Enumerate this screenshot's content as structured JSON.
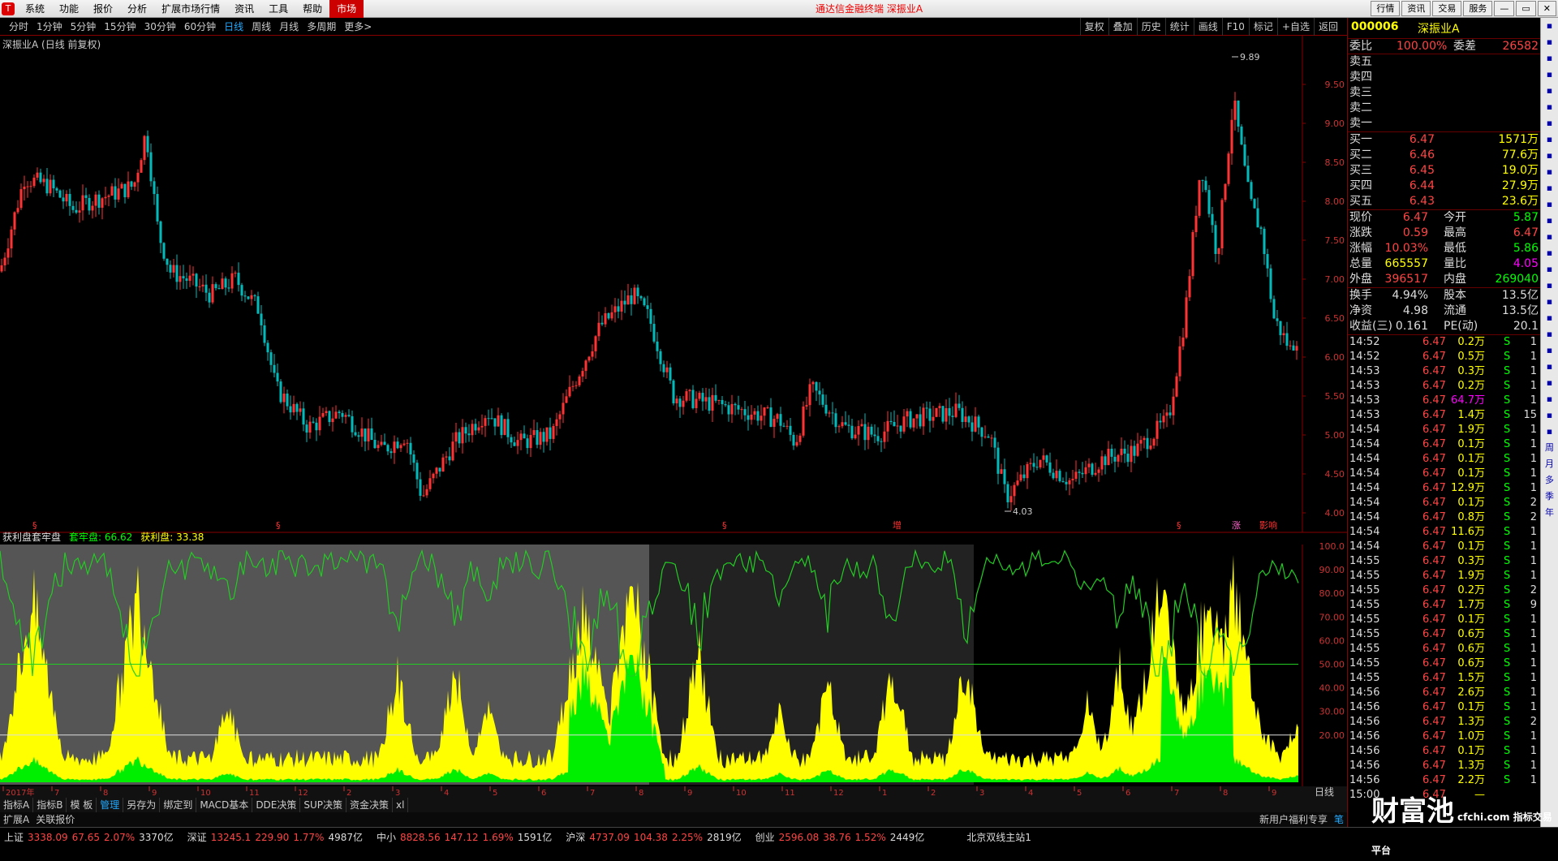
{
  "menubar": {
    "items": [
      "系统",
      "功能",
      "报价",
      "分析",
      "扩展市场行情",
      "资讯",
      "工具",
      "帮助",
      "市场"
    ],
    "app_title": "通达信金融终端  深振业A",
    "window_buttons": [
      "行情",
      "资讯",
      "交易",
      "服务",
      "—",
      "▭",
      "✕"
    ]
  },
  "toolbar": {
    "periods": [
      "分时",
      "1分钟",
      "5分钟",
      "15分钟",
      "30分钟",
      "60分钟",
      "日线",
      "周线",
      "月线",
      "多周期",
      "更多>"
    ],
    "selected": "日线",
    "right_tools": [
      "复权",
      "叠加",
      "历史",
      "统计",
      "画线",
      "F10",
      "标记",
      "+自选",
      "返回"
    ]
  },
  "chart": {
    "stock_label": "深振业A (日线 前复权)",
    "max_label": "9.89",
    "min_label": "4.03",
    "price_axis": [
      "9.50",
      "9.00",
      "8.50",
      "8.00",
      "7.50",
      "7.00",
      "6.50",
      "6.00",
      "5.50",
      "5.00",
      "4.50",
      "4.00"
    ],
    "markers": [
      "§",
      "§",
      "§",
      "增",
      "§",
      "涨",
      "影响"
    ],
    "indicator_axis": [
      "100.0",
      "90.00",
      "80.00",
      "70.00",
      "60.00",
      "50.00",
      "40.00",
      "30.00",
      "20.00"
    ],
    "date_labels": [
      "2017年",
      "7",
      "8",
      "9",
      "10",
      "11",
      "12",
      "2",
      "3",
      "4",
      "5",
      "6",
      "7",
      "8",
      "9",
      "10",
      "11",
      "12",
      "1",
      "2",
      "3",
      "4",
      "5",
      "6",
      "7",
      "8",
      "9"
    ],
    "period_label": "日线"
  },
  "indicator": {
    "name": "获利盘套牢盘",
    "trapped_label": "套牢盘: 66.62",
    "profit_label": "获利盘: 33.38"
  },
  "bottom_tabs": [
    "指标A",
    "指标B",
    "模 板",
    "管理",
    "另存为",
    "绑定到",
    "MACD基本",
    "DDE决策",
    "SUP决策",
    "资金决策",
    "xl"
  ],
  "bottom_tabs_selected": "管理",
  "bottom_tabs2": [
    "扩展A",
    "关联报价"
  ],
  "status_right": [
    "新用户福利专享",
    "笔"
  ],
  "statusbar": [
    {
      "name": "上证",
      "price": "3338.09",
      "chg": "67.65",
      "pct": "2.07%",
      "vol": "3370亿"
    },
    {
      "name": "深证",
      "price": "13245.1",
      "chg": "229.90",
      "pct": "1.77%",
      "vol": "4987亿"
    },
    {
      "name": "中小",
      "price": "8828.56",
      "chg": "147.12",
      "pct": "1.69%",
      "vol": "1591亿"
    },
    {
      "name": "沪深",
      "price": "4737.09",
      "chg": "104.38",
      "pct": "2.25%",
      "vol": "2819亿"
    },
    {
      "name": "创业",
      "price": "2596.08",
      "chg": "38.76",
      "pct": "1.52%",
      "vol": "2449亿"
    }
  ],
  "status_server": "北京双线主站1",
  "quote": {
    "code": "000006",
    "name": "深振业A",
    "weibi_label": "委比",
    "weibi": "100.00%",
    "weicha_label": "委差",
    "weicha": "26582",
    "sells": [
      "卖五",
      "卖四",
      "卖三",
      "卖二",
      "卖一"
    ],
    "buys": [
      {
        "label": "买一",
        "price": "6.47",
        "vol": "1571万"
      },
      {
        "label": "买二",
        "price": "6.46",
        "vol": "77.6万"
      },
      {
        "label": "买三",
        "price": "6.45",
        "vol": "19.0万"
      },
      {
        "label": "买四",
        "price": "6.44",
        "vol": "27.9万"
      },
      {
        "label": "买五",
        "price": "6.43",
        "vol": "23.6万"
      }
    ],
    "stats": [
      {
        "l1": "现价",
        "v1": "6.47",
        "c1": "red",
        "l2": "今开",
        "v2": "5.87",
        "c2": "grn"
      },
      {
        "l1": "涨跌",
        "v1": "0.59",
        "c1": "red",
        "l2": "最高",
        "v2": "6.47",
        "c2": "red"
      },
      {
        "l1": "涨幅",
        "v1": "10.03%",
        "c1": "red",
        "l2": "最低",
        "v2": "5.86",
        "c2": "grn"
      },
      {
        "l1": "总量",
        "v1": "665557",
        "c1": "yel",
        "l2": "量比",
        "v2": "4.05",
        "c2": "mag"
      },
      {
        "l1": "外盘",
        "v1": "396517",
        "c1": "red",
        "l2": "内盘",
        "v2": "269040",
        "c2": "grn"
      }
    ],
    "stats2": [
      {
        "l1": "换手",
        "v1": "4.94%",
        "l2": "股本",
        "v2": "13.5亿"
      },
      {
        "l1": "净资",
        "v1": "4.98",
        "l2": "流通",
        "v2": "13.5亿"
      },
      {
        "l1": "收益(三)",
        "v1": "0.161",
        "l2": "PE(动)",
        "v2": "20.1"
      }
    ],
    "ticks": [
      {
        "t": "14:52",
        "p": "6.47",
        "v": "0.2万",
        "s": "S",
        "n": "1"
      },
      {
        "t": "14:52",
        "p": "6.47",
        "v": "0.5万",
        "s": "S",
        "n": "1"
      },
      {
        "t": "14:53",
        "p": "6.47",
        "v": "0.3万",
        "s": "S",
        "n": "1"
      },
      {
        "t": "14:53",
        "p": "6.47",
        "v": "0.2万",
        "s": "S",
        "n": "1"
      },
      {
        "t": "14:53",
        "p": "6.47",
        "v": "64.7万",
        "s": "S",
        "n": "1"
      },
      {
        "t": "14:53",
        "p": "6.47",
        "v": "1.4万",
        "s": "S",
        "n": "15"
      },
      {
        "t": "14:54",
        "p": "6.47",
        "v": "1.9万",
        "s": "S",
        "n": "1"
      },
      {
        "t": "14:54",
        "p": "6.47",
        "v": "0.1万",
        "s": "S",
        "n": "1"
      },
      {
        "t": "14:54",
        "p": "6.47",
        "v": "0.1万",
        "s": "S",
        "n": "1"
      },
      {
        "t": "14:54",
        "p": "6.47",
        "v": "0.1万",
        "s": "S",
        "n": "1"
      },
      {
        "t": "14:54",
        "p": "6.47",
        "v": "12.9万",
        "s": "S",
        "n": "1"
      },
      {
        "t": "14:54",
        "p": "6.47",
        "v": "0.1万",
        "s": "S",
        "n": "2"
      },
      {
        "t": "14:54",
        "p": "6.47",
        "v": "0.8万",
        "s": "S",
        "n": "2"
      },
      {
        "t": "14:54",
        "p": "6.47",
        "v": "11.6万",
        "s": "S",
        "n": "1"
      },
      {
        "t": "14:54",
        "p": "6.47",
        "v": "0.1万",
        "s": "S",
        "n": "1"
      },
      {
        "t": "14:55",
        "p": "6.47",
        "v": "0.3万",
        "s": "S",
        "n": "1"
      },
      {
        "t": "14:55",
        "p": "6.47",
        "v": "1.9万",
        "s": "S",
        "n": "1"
      },
      {
        "t": "14:55",
        "p": "6.47",
        "v": "0.2万",
        "s": "S",
        "n": "2"
      },
      {
        "t": "14:55",
        "p": "6.47",
        "v": "1.7万",
        "s": "S",
        "n": "9"
      },
      {
        "t": "14:55",
        "p": "6.47",
        "v": "0.1万",
        "s": "S",
        "n": "1"
      },
      {
        "t": "14:55",
        "p": "6.47",
        "v": "0.6万",
        "s": "S",
        "n": "1"
      },
      {
        "t": "14:55",
        "p": "6.47",
        "v": "0.6万",
        "s": "S",
        "n": "1"
      },
      {
        "t": "14:55",
        "p": "6.47",
        "v": "0.6万",
        "s": "S",
        "n": "1"
      },
      {
        "t": "14:55",
        "p": "6.47",
        "v": "1.5万",
        "s": "S",
        "n": "1"
      },
      {
        "t": "14:56",
        "p": "6.47",
        "v": "2.6万",
        "s": "S",
        "n": "1"
      },
      {
        "t": "14:56",
        "p": "6.47",
        "v": "0.1万",
        "s": "S",
        "n": "1"
      },
      {
        "t": "14:56",
        "p": "6.47",
        "v": "1.3万",
        "s": "S",
        "n": "2"
      },
      {
        "t": "14:56",
        "p": "6.47",
        "v": "1.0万",
        "s": "S",
        "n": "1"
      },
      {
        "t": "14:56",
        "p": "6.47",
        "v": "0.1万",
        "s": "S",
        "n": "1"
      },
      {
        "t": "14:56",
        "p": "6.47",
        "v": "1.3万",
        "s": "S",
        "n": "1"
      },
      {
        "t": "14:56",
        "p": "6.47",
        "v": "2.2万",
        "s": "S",
        "n": "1"
      },
      {
        "t": "15:00",
        "p": "6.47",
        "v": "—",
        "s": "",
        "n": ""
      }
    ]
  },
  "rightbar": [
    "周",
    "月",
    "多",
    "季",
    "年"
  ],
  "watermark": {
    "main": "财富池",
    "sub": "cfchi.com 指标交易平台"
  }
}
